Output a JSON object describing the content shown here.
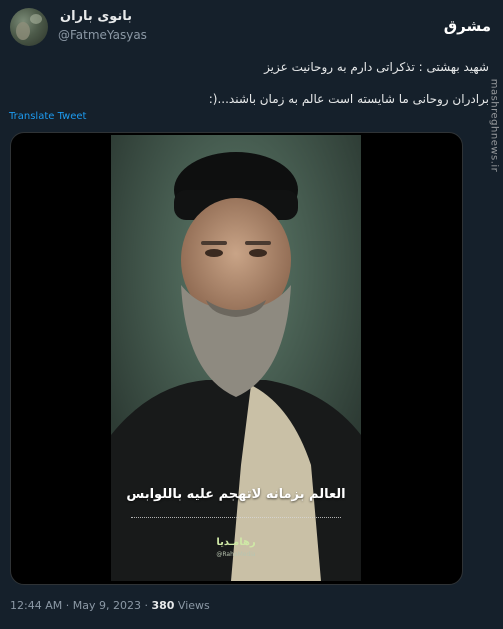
{
  "author": {
    "display_name": "بانوی باران",
    "handle": "@FatmeYasyas"
  },
  "tweet": {
    "line1": "شهید بهشتی : تذکراتی دارم به روحانیت عزیز",
    "line2": "برادران روحانی ما شایسته است عالم به زمان باشند...(:",
    "translate_label": "Translate Tweet"
  },
  "video": {
    "caption": "العالم بزمانه لاتهجم علیه باللوابس",
    "brand": "رهامـدیا",
    "brand_handle": "@RahaMedia"
  },
  "watermark": {
    "logo_text": "مشرق",
    "site": "mashreghnews.ir"
  },
  "meta": {
    "time": "12:44 AM",
    "date": "May 9, 2023",
    "views_count": "380",
    "views_label": "Views",
    "separator": "·"
  },
  "colors": {
    "background": "#15202b",
    "accent": "#1d9bf0",
    "secondary_text": "#8b98a5"
  }
}
